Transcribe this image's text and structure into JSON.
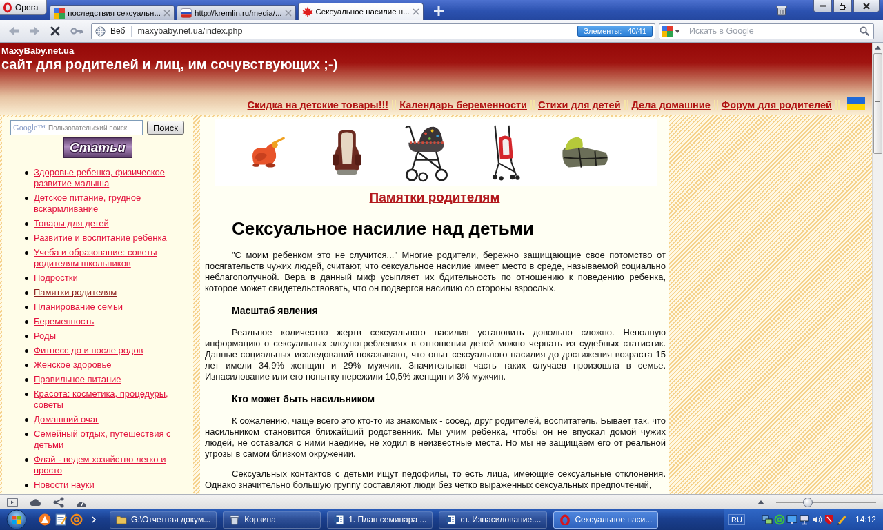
{
  "browser": {
    "menu_button": "Opera",
    "tabs": [
      {
        "title": "последствия сексуальн...",
        "selected": false
      },
      {
        "title": "http://kremlin.ru/media/...",
        "selected": false
      },
      {
        "title": "Сексуальное насилие н...",
        "selected": true
      }
    ]
  },
  "address_bar": {
    "mode_label": "Веб",
    "url": "maxybaby.net.ua/index.php",
    "elements_badge": "Элементы: 40/41"
  },
  "search_bar": {
    "placeholder": "Искать в Google"
  },
  "header": {
    "site_name": "MaxyBaby.net.ua",
    "tagline": "сайт для родителей и лиц, им сочувствующих ;-)",
    "nav": [
      "Скидка на детские товары!!!",
      "Календарь беременности",
      "Стихи для детей",
      "Дела домашние",
      "Форум для родителей"
    ]
  },
  "sidebar": {
    "search": {
      "logo": "Google™",
      "placeholder": "Пользовательский поиск",
      "button": "Поиск"
    },
    "articles_banner": "Статьи",
    "links": [
      {
        "label": "Здоровье ребенка, физическое развитие малыша",
        "visited": false
      },
      {
        "label": "Детское питание, грудное вскармливание",
        "visited": false
      },
      {
        "label": "Товары для детей",
        "visited": false
      },
      {
        "label": "Развитие и воспитание ребенка",
        "visited": false
      },
      {
        "label": "Учеба и образование: советы родителям школьников",
        "visited": false
      },
      {
        "label": "Подростки",
        "visited": false
      },
      {
        "label": "Памятки родителям",
        "visited": true
      },
      {
        "label": "Планирование семьи",
        "visited": false
      },
      {
        "label": "Беременность",
        "visited": false
      },
      {
        "label": "Роды",
        "visited": false
      },
      {
        "label": "Фитнесс до и после родов",
        "visited": false
      },
      {
        "label": "Женское здоровье",
        "visited": false
      },
      {
        "label": "Правильное питание",
        "visited": false
      },
      {
        "label": "Красота: косметика, процедуры, советы",
        "visited": false
      },
      {
        "label": "Домашний очаг",
        "visited": false
      },
      {
        "label": "Семейный отдых, путешествия с детьми",
        "visited": false
      },
      {
        "label": "Флай - ведем хозяйство легко и просто",
        "visited": false
      },
      {
        "label": "Новости науки",
        "visited": false
      }
    ]
  },
  "article": {
    "product_banner": {
      "images": [
        {
          "kind": "ride-on-toy"
        },
        {
          "kind": "car-seat"
        },
        {
          "kind": "pram"
        },
        {
          "kind": "stroller"
        },
        {
          "kind": "carrycot"
        }
      ]
    },
    "section_link": "Памятки родителям",
    "title": "Сексуальное насилие над детьми",
    "blocks": [
      {
        "kind": "paragraph",
        "text": "\"С моим ребенком это не случится...\" Многие родители, бережно защищающие свое потомство от посягательств чужих людей, считают, что сексуальное насилие имеет место в среде, называемой социально неблагополучной. Вера в данный миф усыпляет их бдительность по отношению к поведению ребенка, которое может свидетельствовать, что он подвергся насилию со стороны взрослых."
      },
      {
        "kind": "subheading",
        "text": "Масштаб явления"
      },
      {
        "kind": "paragraph",
        "text": "Реальное количество жертв сексуального насилия установить довольно сложно. Неполную информацию о сексуальных злоупотреблениях в отношении детей можно черпать из судебных статистик. Данные социальных исследований показывают, что опыт сексуального насилия до достижения возраста 15 лет имели 34,9% женщин и 29% мужчин. Значительная часть таких случаев произошла в семье. Изнасилование или его попытку пережили 10,5% женщин и 3% мужчин."
      },
      {
        "kind": "subheading",
        "text": "Кто может быть насильником"
      },
      {
        "kind": "paragraph",
        "text": "К сожалению, чаще всего это кто-то из знакомых - сосед, друг родителей, воспитатель. Бывает так, что насильником становится ближайший родственник. Мы учим ребенка, чтобы он не впускал домой чужих людей, не оставался с ними наедине, не ходил в неизвестные места. Но мы не защищаем его от реальной угрозы в самом близком окружении."
      },
      {
        "kind": "paragraph",
        "text": "Сексуальных контактов с детьми ищут педофилы, то есть лица, имеющие сексуальные отклонения. Однако значительно большую группу составляют люди без четко выраженных сексуальных предпочтений,"
      }
    ]
  },
  "status_bar": {
    "zoom_slider": {
      "level": 0.3
    }
  },
  "taskbar": {
    "tasks": [
      {
        "label": "G:\\Отчетная докум...",
        "selected": false
      },
      {
        "label": "Корзина",
        "selected": false
      },
      {
        "label": "1. План семинара ...",
        "selected": false
      },
      {
        "label": "ст. Изнасилование....",
        "selected": false
      },
      {
        "label": "Сексуальное наси...",
        "selected": true
      }
    ],
    "language": "RU",
    "clock": "14:12"
  }
}
